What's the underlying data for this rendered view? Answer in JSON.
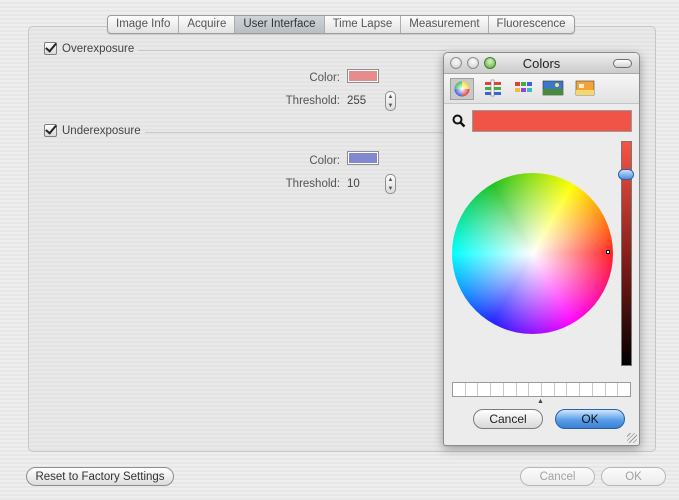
{
  "tabs": [
    {
      "label": "Image Info"
    },
    {
      "label": "Acquire"
    },
    {
      "label": "User Interface",
      "selected": true
    },
    {
      "label": "Time Lapse"
    },
    {
      "label": "Measurement"
    },
    {
      "label": "Fluorescence"
    }
  ],
  "overexposure": {
    "label": "Overexposure",
    "checked": true,
    "color_label": "Color:",
    "color": "#e58d8d",
    "threshold_label": "Threshold:",
    "threshold": "255"
  },
  "underexposure": {
    "label": "Underexposure",
    "checked": true,
    "color_label": "Color:",
    "color": "#8189cf",
    "threshold_label": "Threshold:",
    "threshold": "10"
  },
  "footer": {
    "reset_label": "Reset to Factory Settings",
    "cancel_label": "Cancel",
    "ok_label": "OK"
  },
  "colors_panel": {
    "title": "Colors",
    "modes": [
      "color-wheel-icon",
      "color-sliders-icon",
      "color-palettes-icon",
      "image-palettes-icon",
      "crayons-icon"
    ],
    "selected_mode": "color-wheel-icon",
    "current_color": "#f05446",
    "cancel_label": "Cancel",
    "ok_label": "OK"
  }
}
